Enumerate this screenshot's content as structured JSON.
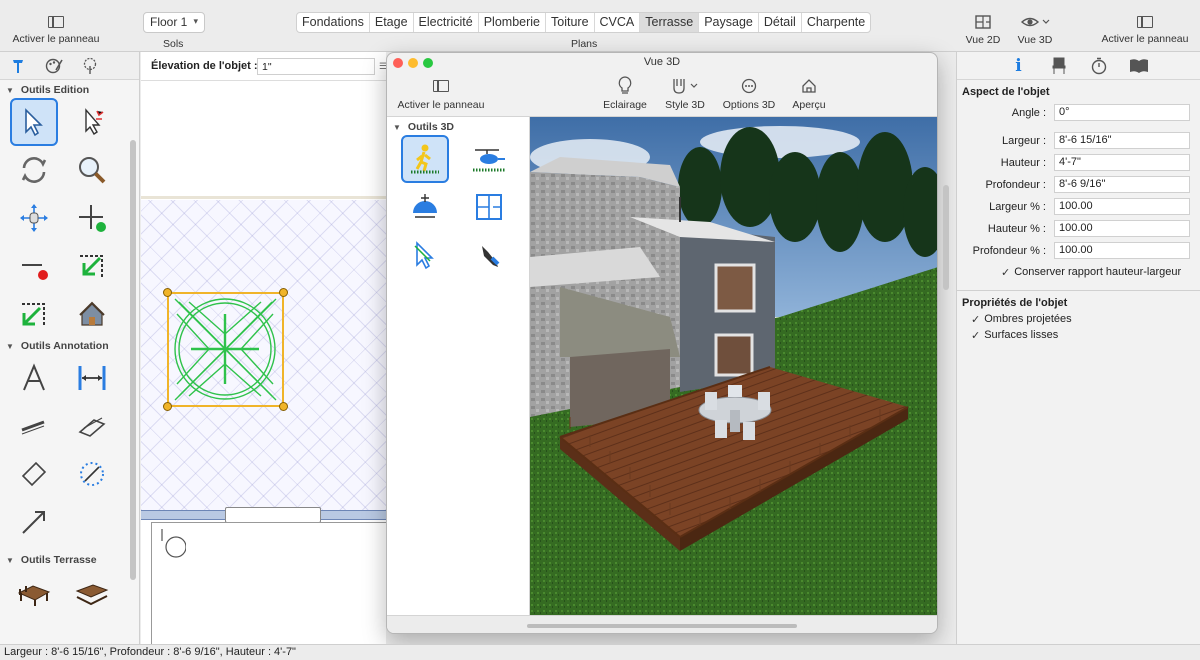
{
  "toolbar": {
    "left_panel_toggle": "Activer le panneau",
    "floor": "Floor 1",
    "floor_group_label": "Sols",
    "plans_group_label": "Plans",
    "plans": [
      "Fondations",
      "Etage",
      "Electricité",
      "Plomberie",
      "Toiture",
      "CVCA",
      "Terrasse",
      "Paysage",
      "Détail",
      "Charpente"
    ],
    "active_plan": "Terrasse",
    "view_2d": "Vue 2D",
    "view_3d": "Vue 3D",
    "right_panel_toggle": "Activer le panneau"
  },
  "left_panel": {
    "tabs": [
      "hammer-icon",
      "palette-icon",
      "tree-icon"
    ],
    "sections": {
      "edition": "Outils Edition",
      "annotation": "Outils Annotation",
      "terrasse": "Outils Terrasse"
    }
  },
  "canvas": {
    "elevation_label": "Élevation de l'objet :",
    "elevation_value": "1\""
  },
  "window3d": {
    "title": "Vue 3D",
    "panel_toggle": "Activer le panneau",
    "lighting": "Eclairage",
    "style3d": "Style 3D",
    "options3d": "Options 3D",
    "preview": "Aperçu",
    "tools_section": "Outils 3D"
  },
  "right_panel": {
    "section_aspect": "Aspect de l'objet",
    "angle_label": "Angle :",
    "angle_value": "0°",
    "width_label": "Largeur :",
    "width_value": "8'-6 15/16\"",
    "height_label": "Hauteur :",
    "height_value": "4'-7\"",
    "depth_label": "Profondeur :",
    "depth_value": "8'-6 9/16\"",
    "width_pct_label": "Largeur % :",
    "width_pct_value": "100.00",
    "height_pct_label": "Hauteur % :",
    "height_pct_value": "100.00",
    "depth_pct_label": "Profondeur % :",
    "depth_pct_value": "100.00",
    "keep_ratio": "Conserver rapport hauteur-largeur",
    "section_props": "Propriétés de l'objet",
    "shadows": "Ombres projetées",
    "smooth": "Surfaces lisses"
  },
  "status": "Largeur : 8'-6 15/16\", Profondeur : 8'-6 9/16\", Hauteur : 4'-7\""
}
